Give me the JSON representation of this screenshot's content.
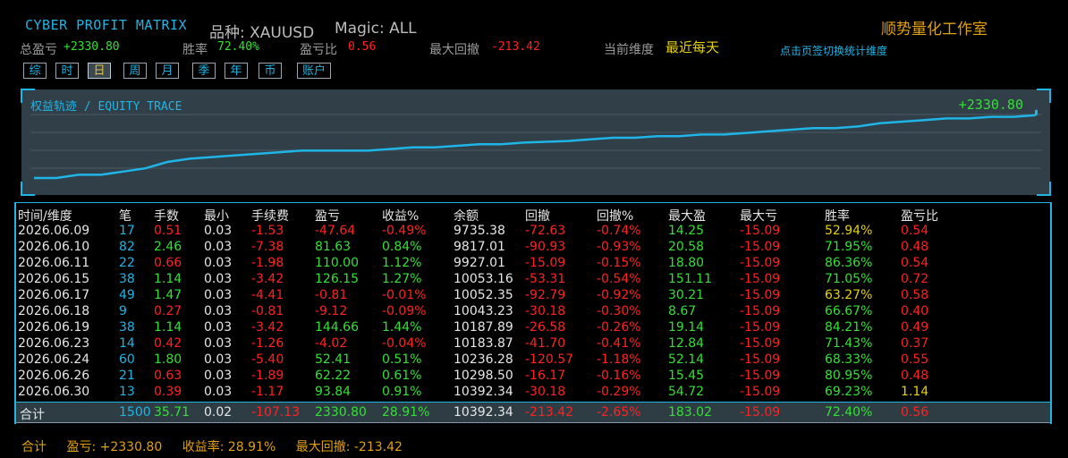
{
  "header": {
    "title": "CYBER PROFIT MATRIX",
    "symbol": "品种: XAUUSD",
    "magic": "Magic: ALL",
    "studio": "顺势量化工作室",
    "switch_hint": "点击页签切换统计维度"
  },
  "stats": {
    "total_profit_label": "总盈亏",
    "total_profit_value": "+2330.80",
    "win_rate_label": "胜率",
    "win_rate_value": "72.40%",
    "pl_ratio_label": "盈亏比",
    "pl_ratio_value": "0.56",
    "max_dd_label": "最大回撤",
    "max_dd_value": "-213.42",
    "dimension_label": "当前维度",
    "dimension_value": "最近每天"
  },
  "tabs": [
    "综",
    "时",
    "日",
    "周",
    "月",
    "季",
    "年",
    "币",
    "账户"
  ],
  "active_tab": 2,
  "equity": {
    "title": "权益轨迹 / EQUITY TRACE",
    "total": "+2330.80",
    "line_color": "#1fb5e6",
    "points": [
      10,
      10,
      14,
      14,
      18,
      22,
      30,
      34,
      36,
      38,
      40,
      42,
      44,
      44,
      44,
      44,
      46,
      48,
      48,
      50,
      52,
      52,
      54,
      55,
      56,
      58,
      60,
      60,
      62,
      62,
      64,
      64,
      66,
      68,
      70,
      72,
      72,
      74,
      78,
      80,
      82,
      84,
      84,
      86,
      86,
      88
    ]
  },
  "table": {
    "headers": [
      "时间/维度",
      "笔",
      "手数",
      "最小",
      "手续费",
      "盈亏",
      "收益%",
      "余额",
      "回撤",
      "回撤%",
      "最大盈",
      "最大亏",
      "胜率",
      "盈亏比"
    ],
    "rows": [
      [
        "2026.06.09",
        "17",
        "0.51",
        "0.03",
        "-1.53",
        "-47.64",
        "-0.49%",
        "9735.38",
        "-72.63",
        "-0.74%",
        "14.25",
        "-15.09",
        "52.94%",
        "0.54"
      ],
      [
        "2026.06.10",
        "82",
        "2.46",
        "0.03",
        "-7.38",
        "81.63",
        "0.84%",
        "9817.01",
        "-90.93",
        "-0.93%",
        "20.58",
        "-15.09",
        "71.95%",
        "0.48"
      ],
      [
        "2026.06.11",
        "22",
        "0.66",
        "0.03",
        "-1.98",
        "110.00",
        "1.12%",
        "9927.01",
        "-15.09",
        "-0.15%",
        "18.80",
        "-15.09",
        "86.36%",
        "0.54"
      ],
      [
        "2026.06.15",
        "38",
        "1.14",
        "0.03",
        "-3.42",
        "126.15",
        "1.27%",
        "10053.16",
        "-53.31",
        "-0.54%",
        "151.11",
        "-15.09",
        "71.05%",
        "0.72"
      ],
      [
        "2026.06.17",
        "49",
        "1.47",
        "0.03",
        "-4.41",
        "-0.81",
        "-0.01%",
        "10052.35",
        "-92.79",
        "-0.92%",
        "30.21",
        "-15.09",
        "63.27%",
        "0.58"
      ],
      [
        "2026.06.18",
        "9",
        "0.27",
        "0.03",
        "-0.81",
        "-9.12",
        "-0.09%",
        "10043.23",
        "-30.18",
        "-0.30%",
        "8.67",
        "-15.09",
        "66.67%",
        "0.40"
      ],
      [
        "2026.06.19",
        "38",
        "1.14",
        "0.03",
        "-3.42",
        "144.66",
        "1.44%",
        "10187.89",
        "-26.58",
        "-0.26%",
        "19.14",
        "-15.09",
        "84.21%",
        "0.49"
      ],
      [
        "2026.06.23",
        "14",
        "0.42",
        "0.03",
        "-1.26",
        "-4.02",
        "-0.04%",
        "10183.87",
        "-41.70",
        "-0.41%",
        "12.84",
        "-15.09",
        "71.43%",
        "0.37"
      ],
      [
        "2026.06.24",
        "60",
        "1.80",
        "0.03",
        "-5.40",
        "52.41",
        "0.51%",
        "10236.28",
        "-120.57",
        "-1.18%",
        "52.14",
        "-15.09",
        "68.33%",
        "0.55"
      ],
      [
        "2026.06.26",
        "21",
        "0.63",
        "0.03",
        "-1.89",
        "62.22",
        "0.61%",
        "10298.50",
        "-16.17",
        "-0.16%",
        "15.45",
        "-15.09",
        "80.95%",
        "0.48"
      ],
      [
        "2026.06.30",
        "13",
        "0.39",
        "0.03",
        "-1.17",
        "93.84",
        "0.91%",
        "10392.34",
        "-30.18",
        "-0.29%",
        "54.72",
        "-15.09",
        "69.23%",
        "1.14"
      ]
    ],
    "total_row": [
      "合计",
      "1500",
      "35.71",
      "0.02",
      "-107.13",
      "2330.80",
      "28.91%",
      "10392.34",
      "-213.42",
      "-2.65%",
      "183.02",
      "-15.09",
      "72.40%",
      "0.56"
    ]
  },
  "footer": {
    "total": "合计",
    "profit": "盈亏: +2330.80",
    "return_rate": "收益率: 28.91%",
    "max_dd": "最大回撤: -213.42"
  }
}
